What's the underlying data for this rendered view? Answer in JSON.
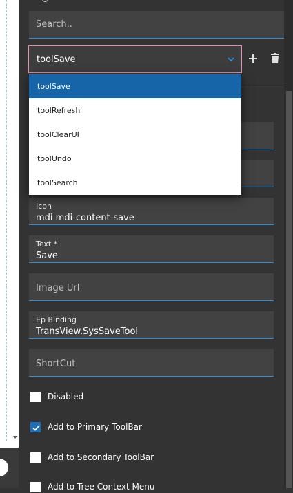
{
  "search": {
    "placeholder": "Search.."
  },
  "tool_select": {
    "selected": "toolSave",
    "options": [
      "toolSave",
      "toolRefresh",
      "toolClearUI",
      "toolUndo",
      "toolSearch"
    ]
  },
  "fields": {
    "icon": {
      "label": "Icon",
      "value": "mdi mdi-content-save"
    },
    "text": {
      "label": "Text *",
      "value": "Save"
    },
    "image_url": {
      "placeholder": "Image Url"
    },
    "ep_binding": {
      "label": "Ep Binding",
      "value": "TransView.SysSaveTool"
    },
    "shortcut": {
      "placeholder": "ShortCut"
    }
  },
  "checkboxes": [
    {
      "label": "Disabled",
      "checked": false
    },
    {
      "label": "Add to Primary ToolBar",
      "checked": true
    },
    {
      "label": "Add to Secondary ToolBar",
      "checked": false
    },
    {
      "label": "Add to Tree Context Menu",
      "checked": false
    }
  ],
  "icons": {
    "add": "plus-icon",
    "delete": "trash-icon",
    "expand": "chevron-down-icon",
    "check": "checkmark-icon"
  },
  "colors": {
    "accent": "#2a8fdc",
    "selected": "#1565a8",
    "focus_border": "#e88bb5",
    "panel": "#333333"
  }
}
